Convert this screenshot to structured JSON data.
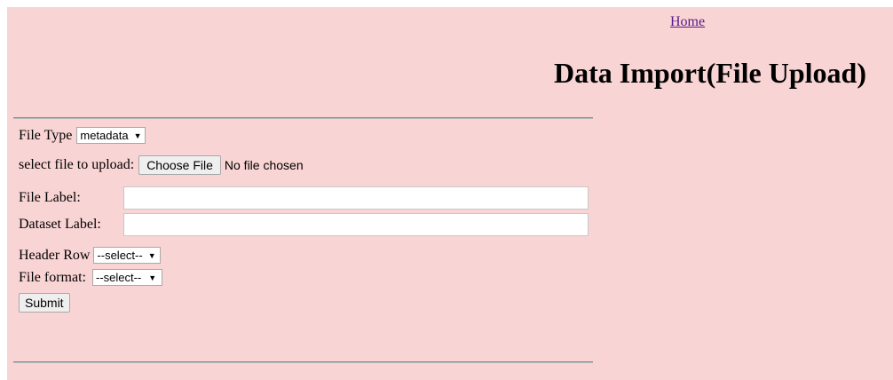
{
  "header": {
    "home_link": "Home",
    "title": "Data Import(File Upload)"
  },
  "form": {
    "file_type": {
      "label": "File Type",
      "selected": "metadata"
    },
    "file_upload": {
      "label": "select file to upload:",
      "button_label": "Choose File",
      "status": "No file chosen"
    },
    "file_label": {
      "label": "File Label:",
      "value": ""
    },
    "dataset_label": {
      "label": "Dataset Label:",
      "value": ""
    },
    "header_row": {
      "label": "Header Row",
      "selected": "--select--"
    },
    "file_format": {
      "label": "File format:",
      "selected": "--select--"
    },
    "submit_label": "Submit"
  },
  "colors": {
    "background": "#f9d4d4",
    "link": "#551a8b",
    "rule": "#8c8c8c"
  },
  "icons": {
    "dropdown": "caret-down-icon"
  }
}
